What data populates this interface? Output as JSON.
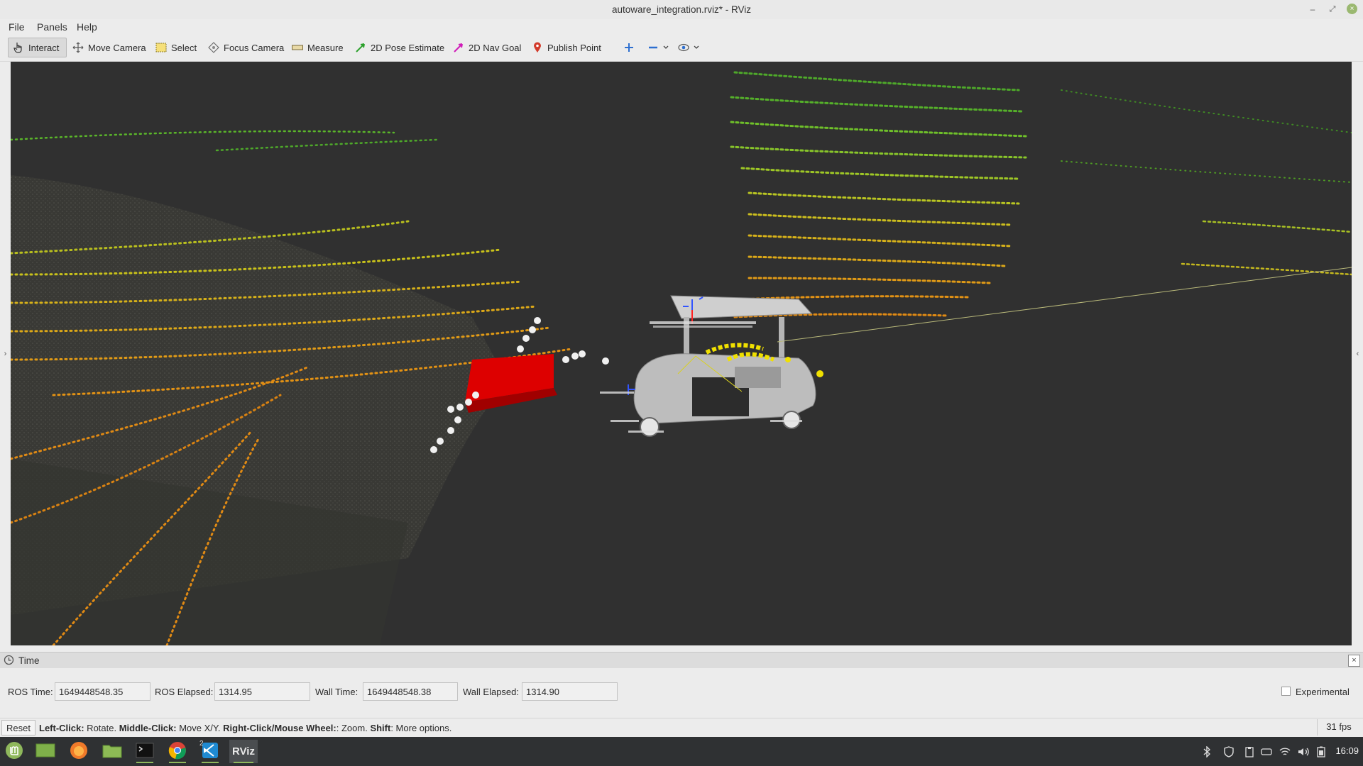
{
  "window": {
    "title": "autoware_integration.rviz* - RViz",
    "minimize": "–",
    "maximize": "⤢",
    "close": "×"
  },
  "menu": {
    "file": "File",
    "panels": "Panels",
    "help": "Help"
  },
  "toolbar": {
    "interact": "Interact",
    "move_camera": "Move Camera",
    "select": "Select",
    "focus_camera": "Focus Camera",
    "measure": "Measure",
    "pose_estimate": "2D Pose Estimate",
    "nav_goal": "2D Nav Goal",
    "publish_point": "Publish Point"
  },
  "viewport": {
    "background": "#303030",
    "obstacle_color": "#dd0000",
    "cloud_colors": [
      "#e08a14",
      "#d2c21a",
      "#6fc02a",
      "#3a9a22"
    ]
  },
  "side_arrows": {
    "left": "›",
    "right": "‹"
  },
  "time_panel": {
    "title": "Time",
    "close": "×",
    "ros_time_label": "ROS Time:",
    "ros_time": "1649448548.35",
    "ros_elapsed_label": "ROS Elapsed:",
    "ros_elapsed": "1314.95",
    "wall_time_label": "Wall Time:",
    "wall_time": "1649448548.38",
    "wall_elapsed_label": "Wall Elapsed:",
    "wall_elapsed": "1314.90",
    "experimental_label": "Experimental"
  },
  "status": {
    "reset": "Reset",
    "left_click": "Left-Click:",
    "left_click_desc": " Rotate. ",
    "middle_click": "Middle-Click:",
    "middle_click_desc": " Move X/Y. ",
    "right_click": "Right-Click/Mouse Wheel:",
    "right_click_desc": ": Zoom. ",
    "shift": "Shift",
    "shift_desc": ": More options.",
    "fps": "31 fps"
  },
  "taskbar": {
    "rviz_label": "RViz",
    "vscode_badge": "2",
    "clock": "16:09"
  }
}
